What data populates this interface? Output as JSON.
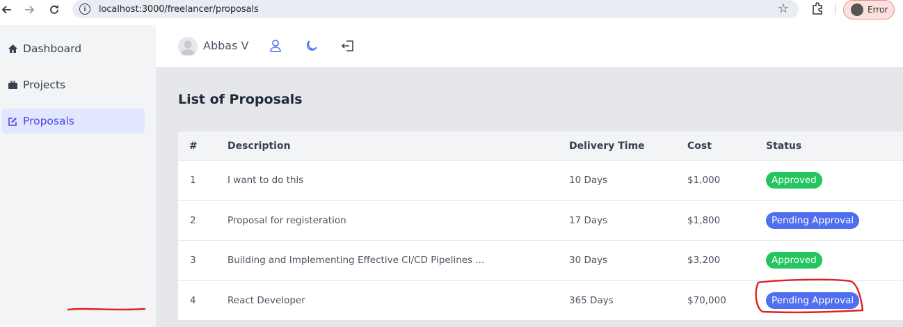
{
  "browser": {
    "url": "localhost:3000/freelancer/proposals",
    "profile_label": "Error"
  },
  "sidebar": {
    "items": [
      {
        "label": "Dashboard",
        "icon": "home-icon"
      },
      {
        "label": "Projects",
        "icon": "briefcase-icon"
      },
      {
        "label": "Proposals",
        "icon": "edit-icon",
        "active": true
      }
    ]
  },
  "header": {
    "user_name": "Abbas V",
    "icons": [
      "user-icon",
      "moon-icon",
      "logout-icon"
    ]
  },
  "main": {
    "title": "List of Proposals",
    "columns": [
      "#",
      "Description",
      "Delivery Time",
      "Cost",
      "Status"
    ],
    "rows": [
      {
        "num": "1",
        "description": "I want to do this",
        "delivery": "10 Days",
        "cost": "$1,000",
        "status": "Approved"
      },
      {
        "num": "2",
        "description": "Proposal for registeration",
        "delivery": "17 Days",
        "cost": "$1,800",
        "status": "Pending Approval"
      },
      {
        "num": "3",
        "description": "Building and Implementing Effective CI/CD Pipelines ...",
        "delivery": "30 Days",
        "cost": "$3,200",
        "status": "Approved"
      },
      {
        "num": "4",
        "description": "React Developer",
        "delivery": "365 Days",
        "cost": "$70,000",
        "status": "Pending Approval"
      }
    ]
  },
  "colors": {
    "approved": "#22c55e",
    "pending": "#4f6ff0",
    "accent": "#4f46e5",
    "annotation": "#e0201c"
  }
}
